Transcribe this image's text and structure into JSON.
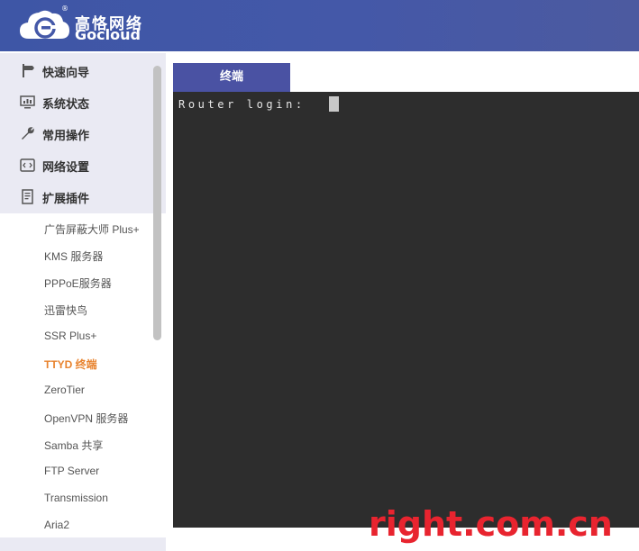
{
  "brand": {
    "name_cn": "高恪网络",
    "name_en": "Gocloud",
    "registered": "®",
    "color_header": "#4458a8"
  },
  "sidebar": {
    "main_items": [
      {
        "label": "快速向导",
        "icon": "signpost-icon"
      },
      {
        "label": "系统状态",
        "icon": "monitor-chart-icon"
      },
      {
        "label": "常用操作",
        "icon": "wrench-icon"
      },
      {
        "label": "网络设置",
        "icon": "code-window-icon"
      },
      {
        "label": "扩展插件",
        "icon": "document-icon"
      }
    ],
    "sub_items": [
      {
        "label": "广告屏蔽大师 Plus+"
      },
      {
        "label": "KMS 服务器"
      },
      {
        "label": "PPPoE服务器"
      },
      {
        "label": "迅雷快鸟"
      },
      {
        "label": "SSR Plus+"
      },
      {
        "label": "TTYD 终端",
        "active": true
      },
      {
        "label": "ZeroTier"
      },
      {
        "label": "OpenVPN 服务器"
      },
      {
        "label": "Samba 共享"
      },
      {
        "label": "FTP Server"
      },
      {
        "label": "Transmission"
      },
      {
        "label": "Aria2"
      }
    ],
    "active_color": "#e8832e"
  },
  "main": {
    "tab_label": "终端",
    "terminal_text": "Router login: "
  },
  "watermark": {
    "text": "right.com.cn",
    "color": "#e8242f"
  }
}
